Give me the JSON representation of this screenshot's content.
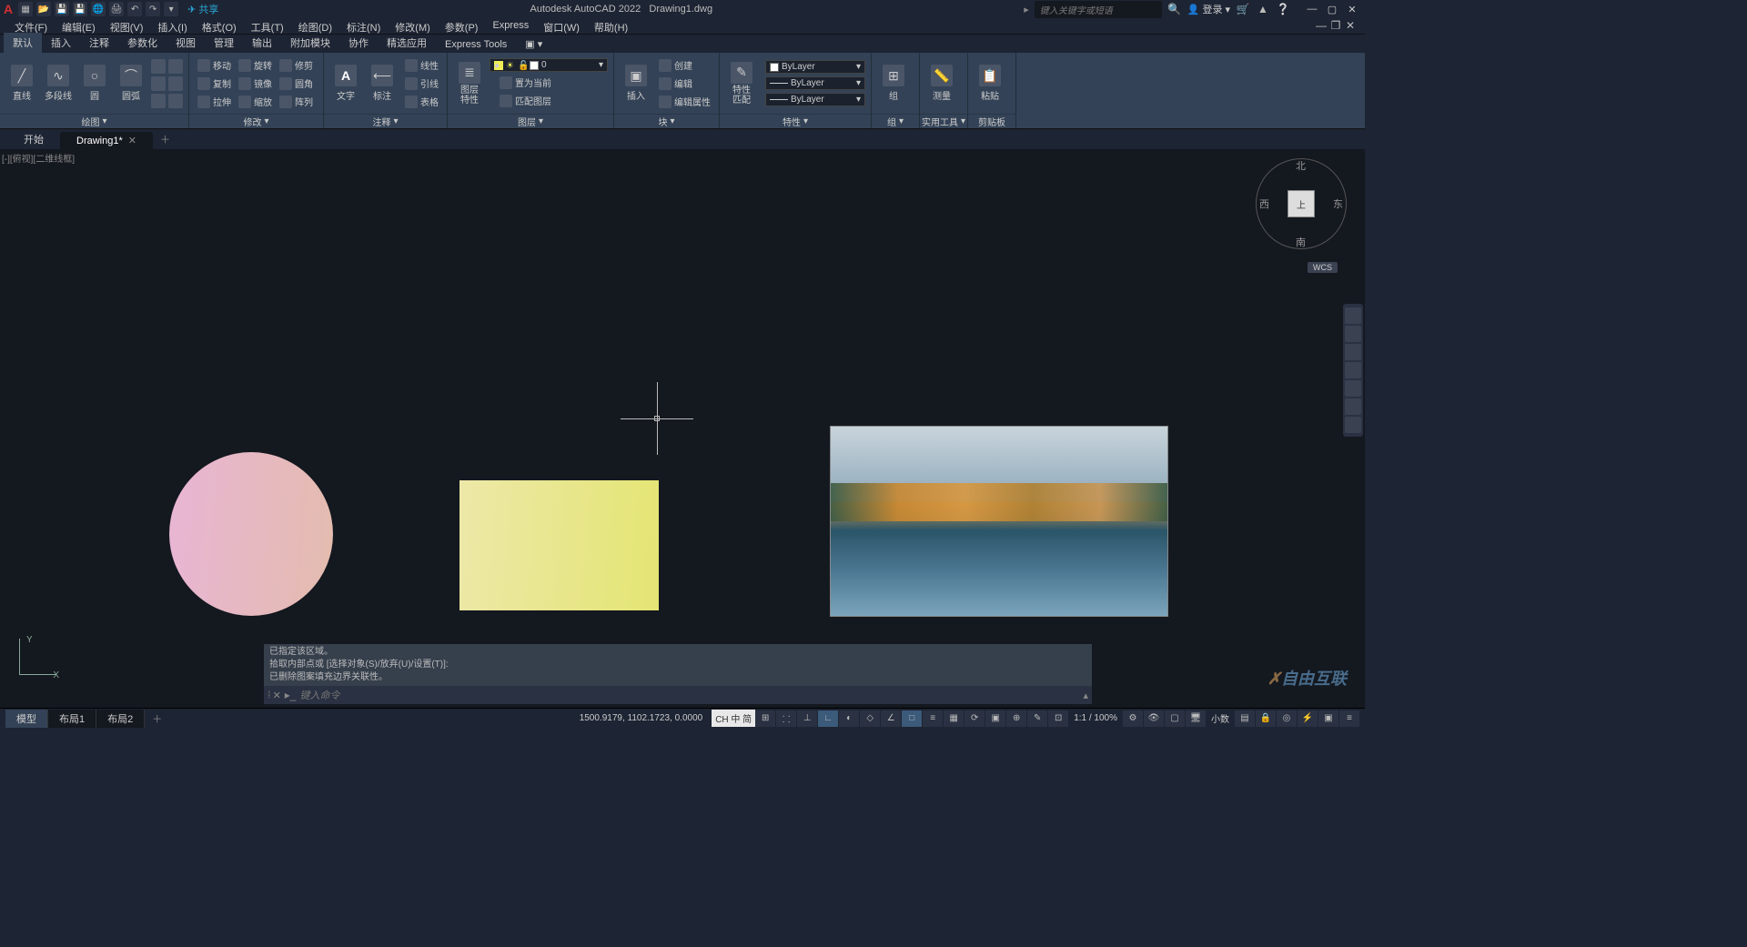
{
  "titlebar": {
    "app": "Autodesk AutoCAD 2022",
    "doc": "Drawing1.dwg",
    "share": "共享",
    "search_placeholder": "键入关键字或短语",
    "login": "登录"
  },
  "menu": [
    "文件(F)",
    "编辑(E)",
    "视图(V)",
    "插入(I)",
    "格式(O)",
    "工具(T)",
    "绘图(D)",
    "标注(N)",
    "修改(M)",
    "参数(P)",
    "Express",
    "窗口(W)",
    "帮助(H)"
  ],
  "ribbon_tabs": [
    "默认",
    "插入",
    "注释",
    "参数化",
    "视图",
    "管理",
    "输出",
    "附加模块",
    "协作",
    "精选应用",
    "Express Tools"
  ],
  "ribbon": {
    "draw": {
      "title": "绘图",
      "b1": "直线",
      "b2": "多段线",
      "b3": "圆",
      "b4": "圆弧"
    },
    "modify": {
      "title": "修改",
      "r1a": "移动",
      "r1b": "旋转",
      "r1c": "修剪",
      "r2a": "复制",
      "r2b": "镜像",
      "r2c": "圆角",
      "r3a": "拉伸",
      "r3b": "缩放",
      "r3c": "阵列"
    },
    "annot": {
      "title": "注释",
      "b1": "文字",
      "r1": "标注",
      "r2": "线性",
      "r3": "引线",
      "r4": "表格"
    },
    "layer": {
      "title": "图层",
      "b1": "图层\n特性",
      "r1": "置为当前",
      "r2": "匹配图层",
      "combo": "0"
    },
    "block": {
      "title": "块",
      "b1": "插入",
      "r1": "创建",
      "r2": "编辑",
      "r3": "编辑属性"
    },
    "props": {
      "title": "特性",
      "b1": "特性\n匹配",
      "c1": "ByLayer",
      "c2": "ByLayer",
      "c3": "ByLayer"
    },
    "group": {
      "title": "组",
      "b1": "组"
    },
    "util": {
      "title": "实用工具",
      "b1": "测量"
    },
    "clip": {
      "title": "剪贴板",
      "b1": "粘贴"
    }
  },
  "doctabs": {
    "t1": "开始",
    "t2": "Drawing1*"
  },
  "canvas": {
    "view_label": "[-][俯视][二维线框]",
    "cube_top": "上",
    "cube_n": "北",
    "cube_s": "南",
    "cube_w": "西",
    "cube_e": "东",
    "wcs": "WCS",
    "y": "Y",
    "x": "X"
  },
  "cmd": {
    "h1": "已指定该区域。",
    "h2": "拾取内部点或 [选择对象(S)/放弃(U)/设置(T)]:",
    "h3": "已删除图案填充边界关联性。",
    "placeholder": "键入命令"
  },
  "status": {
    "t1": "模型",
    "t2": "布局1",
    "t3": "布局2",
    "coords": "1500.9179, 1102.1723, 0.0000",
    "ime": "CH 中 简",
    "scale": "1:1 / 100%",
    "decimal": "小数"
  },
  "watermark": "自由互联"
}
